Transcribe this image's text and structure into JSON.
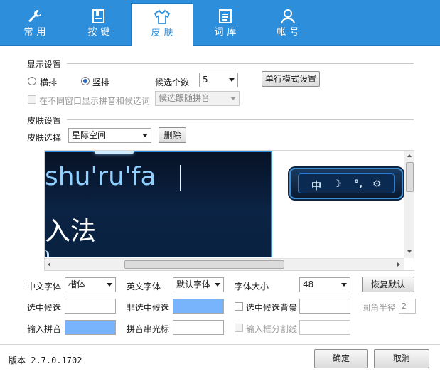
{
  "tabs": [
    {
      "label": "常用",
      "icon": "wrench-icon"
    },
    {
      "label": "按键",
      "icon": "keyboard-icon"
    },
    {
      "label": "皮肤",
      "icon": "tshirt-icon",
      "active": true
    },
    {
      "label": "词库",
      "icon": "dictionary-icon"
    },
    {
      "label": "帐号",
      "icon": "user-icon"
    }
  ],
  "display": {
    "section_title": "显示设置",
    "horizontal_label": "横排",
    "vertical_label": "竖排",
    "selected_orientation": "竖排",
    "candidate_count_label": "候选个数",
    "candidate_count_value": "5",
    "single_line_button": "单行模式设置",
    "separate_window_label": "在不同窗口显示拼音和候选词",
    "follow_select_value": "候选跟随拼音"
  },
  "skin": {
    "section_title": "皮肤设置",
    "select_label": "皮肤选择",
    "select_value": "星际空间",
    "delete_button": "删除"
  },
  "preview": {
    "pinyin_text": "shu'ru'fa",
    "candidate_text": "入法",
    "status_items": [
      "中",
      "☽",
      "°,",
      "⚙"
    ]
  },
  "fonts": {
    "cn_font_label": "中文字体",
    "cn_font_value": "楷体",
    "en_font_label": "英文字体",
    "en_font_value": "默认字体",
    "size_label": "字体大小",
    "size_value": "48",
    "restore_button": "恢复默认",
    "selected_cand_label": "选中候选",
    "unselected_cand_label": "非选中候选",
    "selected_bg_label": "选中候选背景",
    "corner_radius_label": "圆角半径",
    "corner_radius_value": "2",
    "input_pinyin_label": "输入拼音",
    "pinyin_cursor_label": "拼音串光标",
    "input_divider_label": "输入框分割线"
  },
  "footer": {
    "version": "版本 2.7.0.1702",
    "ok_button": "确定",
    "cancel_button": "取消"
  },
  "colors": {
    "tab_bar": "#2d8fdc",
    "swatch_blue": "#77b4fb"
  }
}
